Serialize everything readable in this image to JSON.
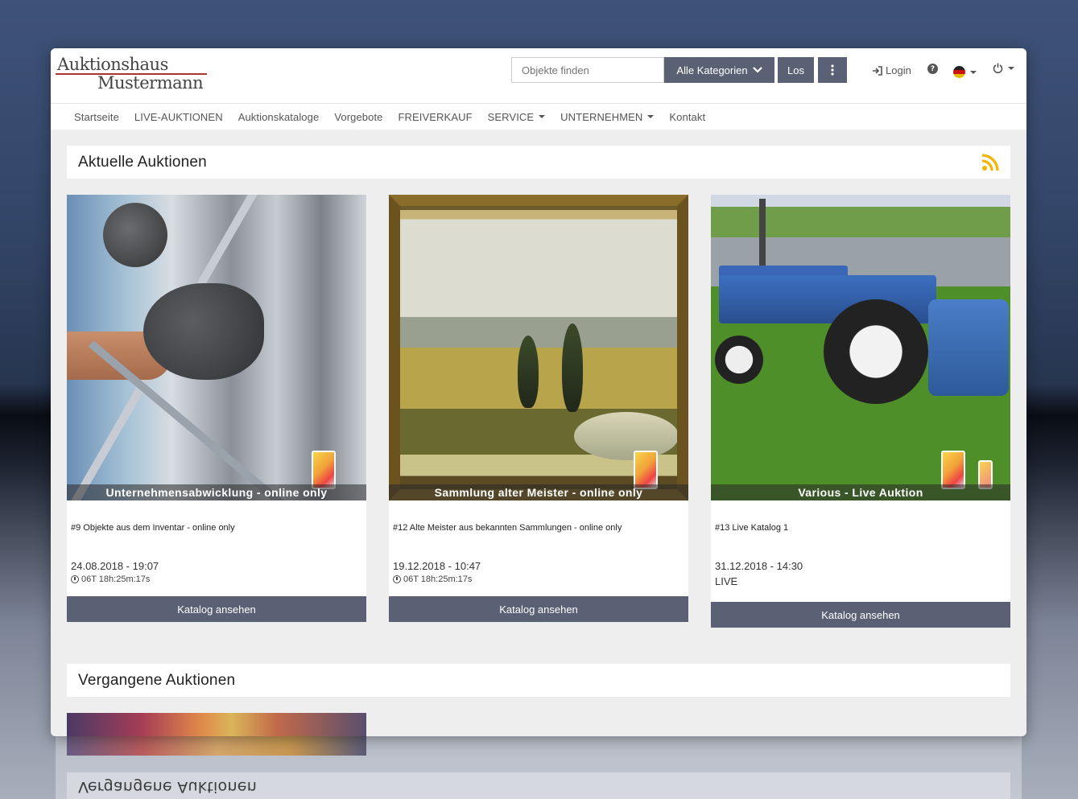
{
  "logo": {
    "line1": "Auktionshaus",
    "line2": "Mustermann"
  },
  "search": {
    "placeholder": "Objekte finden",
    "category_label": "Alle Kategorien",
    "go_label": "Los"
  },
  "header": {
    "login_label": "Login"
  },
  "nav": {
    "items": [
      {
        "label": "Startseite",
        "dropdown": false
      },
      {
        "label": "LIVE-AUKTIONEN",
        "dropdown": false
      },
      {
        "label": "Auktionskataloge",
        "dropdown": false
      },
      {
        "label": "Vorgebote",
        "dropdown": false
      },
      {
        "label": "FREIVERKAUF",
        "dropdown": false
      },
      {
        "label": "SERVICE",
        "dropdown": true
      },
      {
        "label": "UNTERNEHMEN",
        "dropdown": true
      },
      {
        "label": "Kontakt",
        "dropdown": false
      }
    ]
  },
  "current": {
    "title": "Aktuelle Auktionen",
    "cards": [
      {
        "caption": "Unternehmensabwicklung - online only",
        "description": "#9 Objekte aus dem Inventar - online only",
        "date": "24.08.2018 - 19:07",
        "timer": "06T 18h:25m:17s",
        "button": "Katalog ansehen"
      },
      {
        "caption": "Sammlung alter Meister - online only",
        "description": "#12 Alte Meister aus bekannten Sammlungen - online only",
        "date": "19.12.2018 - 10:47",
        "timer": "06T 18h:25m:17s",
        "button": "Katalog ansehen"
      },
      {
        "caption": "Various - Live Auktion",
        "description": "#13 Live Katalog 1",
        "date": "31.12.2018 - 14:30",
        "status": "LIVE",
        "button": "Katalog ansehen"
      }
    ]
  },
  "past": {
    "title": "Vergangene Auktionen"
  },
  "colors": {
    "button_bg": "#5b6175",
    "rss": "#f5b400",
    "logo_line": "#aa3333"
  }
}
